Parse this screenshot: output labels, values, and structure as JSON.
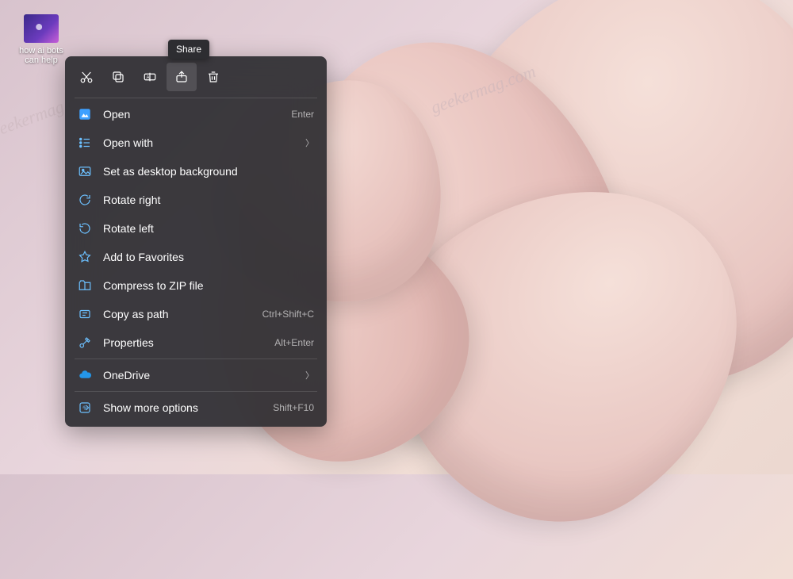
{
  "desktop": {
    "icon_label": "how ai bots can help"
  },
  "tooltip": {
    "share": "Share"
  },
  "toolbar": {
    "icons": [
      "cut",
      "copy",
      "rename",
      "share",
      "delete"
    ]
  },
  "menu": {
    "open": {
      "label": "Open",
      "shortcut": "Enter"
    },
    "open_with": {
      "label": "Open with"
    },
    "set_bg": {
      "label": "Set as desktop background"
    },
    "rotate_right": {
      "label": "Rotate right"
    },
    "rotate_left": {
      "label": "Rotate left"
    },
    "favorites": {
      "label": "Add to Favorites"
    },
    "compress": {
      "label": "Compress to ZIP file"
    },
    "copy_path": {
      "label": "Copy as path",
      "shortcut": "Ctrl+Shift+C"
    },
    "properties": {
      "label": "Properties",
      "shortcut": "Alt+Enter"
    },
    "onedrive": {
      "label": "OneDrive"
    },
    "more": {
      "label": "Show more options",
      "shortcut": "Shift+F10"
    }
  },
  "watermark": "geekermag.com"
}
